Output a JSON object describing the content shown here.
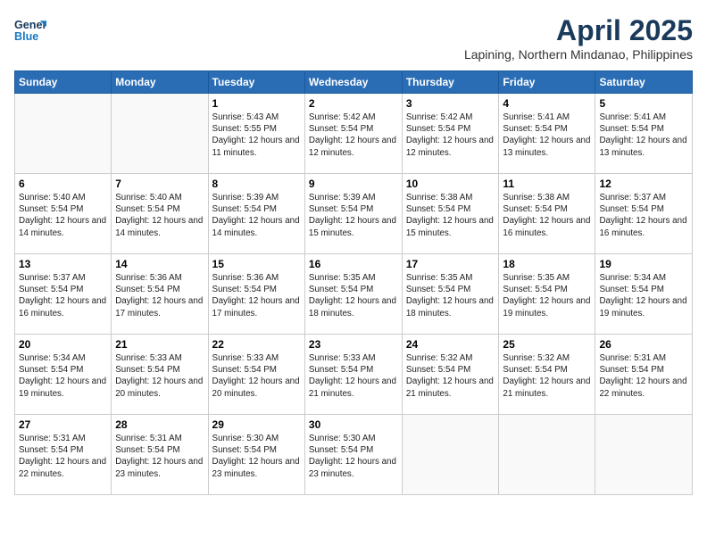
{
  "header": {
    "logo_line1": "General",
    "logo_line2": "Blue",
    "month_title": "April 2025",
    "subtitle": "Lapining, Northern Mindanao, Philippines"
  },
  "weekdays": [
    "Sunday",
    "Monday",
    "Tuesday",
    "Wednesday",
    "Thursday",
    "Friday",
    "Saturday"
  ],
  "weeks": [
    [
      {
        "day": "",
        "info": ""
      },
      {
        "day": "",
        "info": ""
      },
      {
        "day": "1",
        "info": "Sunrise: 5:43 AM\nSunset: 5:55 PM\nDaylight: 12 hours and 11 minutes."
      },
      {
        "day": "2",
        "info": "Sunrise: 5:42 AM\nSunset: 5:54 PM\nDaylight: 12 hours and 12 minutes."
      },
      {
        "day": "3",
        "info": "Sunrise: 5:42 AM\nSunset: 5:54 PM\nDaylight: 12 hours and 12 minutes."
      },
      {
        "day": "4",
        "info": "Sunrise: 5:41 AM\nSunset: 5:54 PM\nDaylight: 12 hours and 13 minutes."
      },
      {
        "day": "5",
        "info": "Sunrise: 5:41 AM\nSunset: 5:54 PM\nDaylight: 12 hours and 13 minutes."
      }
    ],
    [
      {
        "day": "6",
        "info": "Sunrise: 5:40 AM\nSunset: 5:54 PM\nDaylight: 12 hours and 14 minutes."
      },
      {
        "day": "7",
        "info": "Sunrise: 5:40 AM\nSunset: 5:54 PM\nDaylight: 12 hours and 14 minutes."
      },
      {
        "day": "8",
        "info": "Sunrise: 5:39 AM\nSunset: 5:54 PM\nDaylight: 12 hours and 14 minutes."
      },
      {
        "day": "9",
        "info": "Sunrise: 5:39 AM\nSunset: 5:54 PM\nDaylight: 12 hours and 15 minutes."
      },
      {
        "day": "10",
        "info": "Sunrise: 5:38 AM\nSunset: 5:54 PM\nDaylight: 12 hours and 15 minutes."
      },
      {
        "day": "11",
        "info": "Sunrise: 5:38 AM\nSunset: 5:54 PM\nDaylight: 12 hours and 16 minutes."
      },
      {
        "day": "12",
        "info": "Sunrise: 5:37 AM\nSunset: 5:54 PM\nDaylight: 12 hours and 16 minutes."
      }
    ],
    [
      {
        "day": "13",
        "info": "Sunrise: 5:37 AM\nSunset: 5:54 PM\nDaylight: 12 hours and 16 minutes."
      },
      {
        "day": "14",
        "info": "Sunrise: 5:36 AM\nSunset: 5:54 PM\nDaylight: 12 hours and 17 minutes."
      },
      {
        "day": "15",
        "info": "Sunrise: 5:36 AM\nSunset: 5:54 PM\nDaylight: 12 hours and 17 minutes."
      },
      {
        "day": "16",
        "info": "Sunrise: 5:35 AM\nSunset: 5:54 PM\nDaylight: 12 hours and 18 minutes."
      },
      {
        "day": "17",
        "info": "Sunrise: 5:35 AM\nSunset: 5:54 PM\nDaylight: 12 hours and 18 minutes."
      },
      {
        "day": "18",
        "info": "Sunrise: 5:35 AM\nSunset: 5:54 PM\nDaylight: 12 hours and 19 minutes."
      },
      {
        "day": "19",
        "info": "Sunrise: 5:34 AM\nSunset: 5:54 PM\nDaylight: 12 hours and 19 minutes."
      }
    ],
    [
      {
        "day": "20",
        "info": "Sunrise: 5:34 AM\nSunset: 5:54 PM\nDaylight: 12 hours and 19 minutes."
      },
      {
        "day": "21",
        "info": "Sunrise: 5:33 AM\nSunset: 5:54 PM\nDaylight: 12 hours and 20 minutes."
      },
      {
        "day": "22",
        "info": "Sunrise: 5:33 AM\nSunset: 5:54 PM\nDaylight: 12 hours and 20 minutes."
      },
      {
        "day": "23",
        "info": "Sunrise: 5:33 AM\nSunset: 5:54 PM\nDaylight: 12 hours and 21 minutes."
      },
      {
        "day": "24",
        "info": "Sunrise: 5:32 AM\nSunset: 5:54 PM\nDaylight: 12 hours and 21 minutes."
      },
      {
        "day": "25",
        "info": "Sunrise: 5:32 AM\nSunset: 5:54 PM\nDaylight: 12 hours and 21 minutes."
      },
      {
        "day": "26",
        "info": "Sunrise: 5:31 AM\nSunset: 5:54 PM\nDaylight: 12 hours and 22 minutes."
      }
    ],
    [
      {
        "day": "27",
        "info": "Sunrise: 5:31 AM\nSunset: 5:54 PM\nDaylight: 12 hours and 22 minutes."
      },
      {
        "day": "28",
        "info": "Sunrise: 5:31 AM\nSunset: 5:54 PM\nDaylight: 12 hours and 23 minutes."
      },
      {
        "day": "29",
        "info": "Sunrise: 5:30 AM\nSunset: 5:54 PM\nDaylight: 12 hours and 23 minutes."
      },
      {
        "day": "30",
        "info": "Sunrise: 5:30 AM\nSunset: 5:54 PM\nDaylight: 12 hours and 23 minutes."
      },
      {
        "day": "",
        "info": ""
      },
      {
        "day": "",
        "info": ""
      },
      {
        "day": "",
        "info": ""
      }
    ]
  ]
}
